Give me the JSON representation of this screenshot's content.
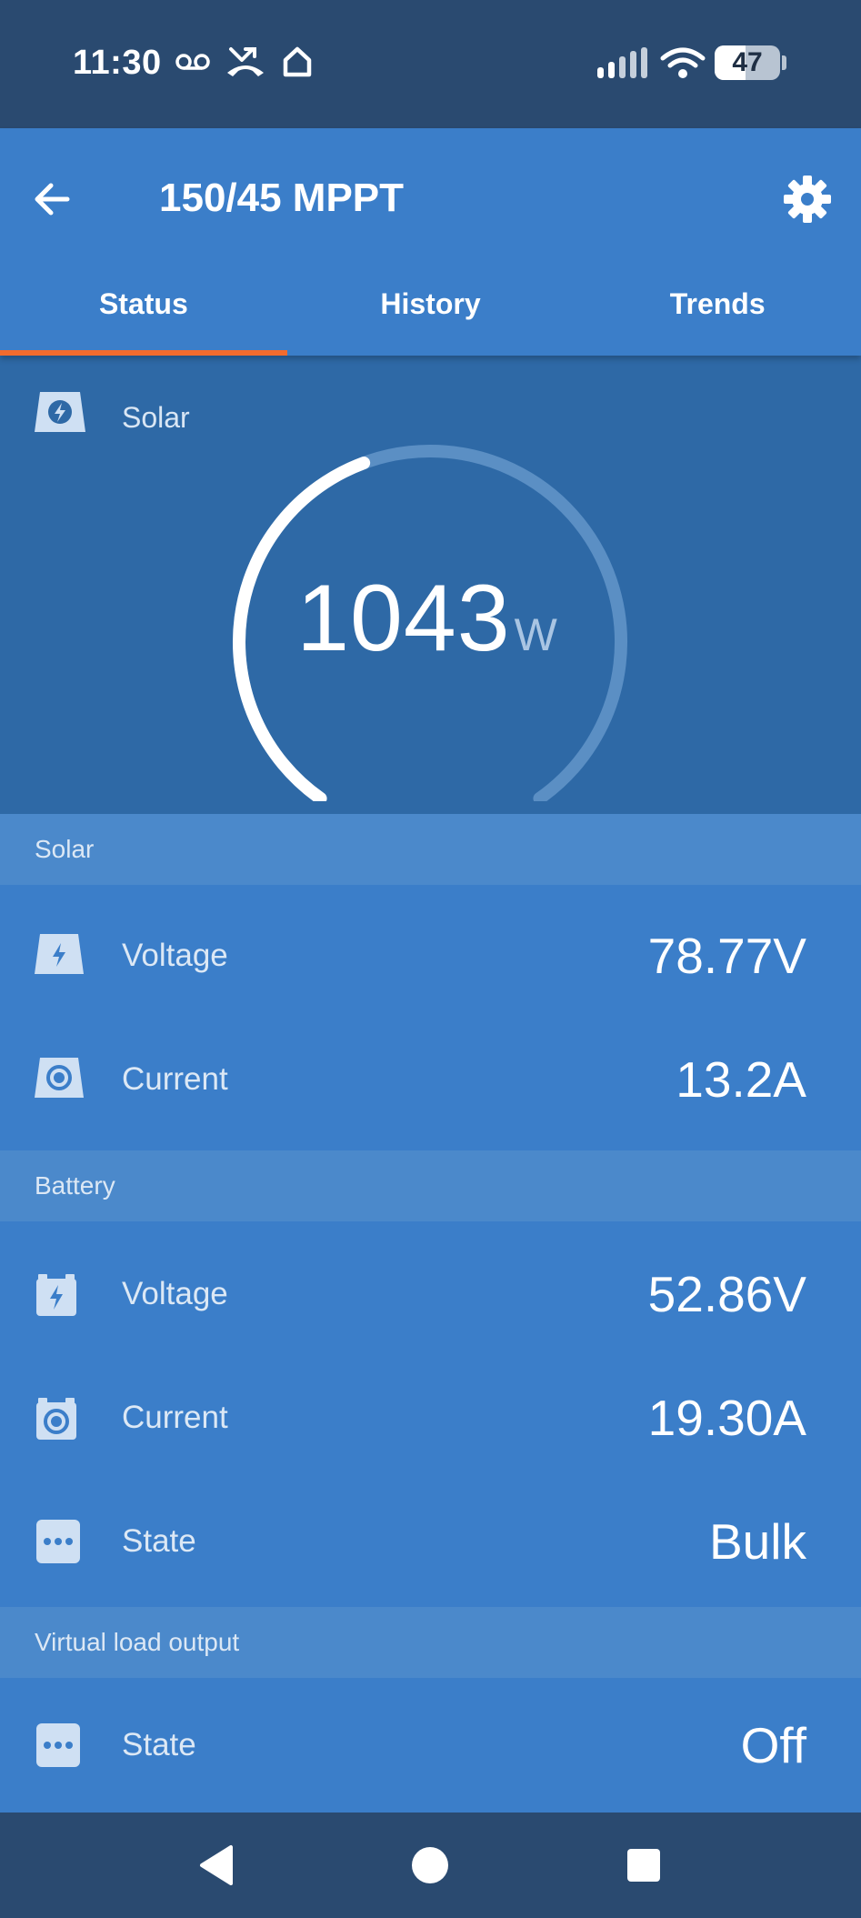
{
  "status_bar": {
    "time": "11:30",
    "battery_level": "47",
    "battery_fraction": 0.47,
    "icons": [
      "voicemail-icon",
      "missed-call-icon",
      "home-icon",
      "signal-icon",
      "wifi-icon",
      "battery-icon"
    ]
  },
  "app_bar": {
    "title": "150/45 MPPT",
    "back_icon": "arrow-left-icon",
    "settings_icon": "gear-icon"
  },
  "tabs": [
    {
      "label": "Status",
      "active": true
    },
    {
      "label": "History",
      "active": false
    },
    {
      "label": "Trends",
      "active": false
    }
  ],
  "hero": {
    "label": "Solar",
    "icon": "solar-panel-bolt-icon",
    "value": "1043",
    "unit": "W",
    "gauge_fraction": 0.43
  },
  "sections": {
    "solar": {
      "header": "Solar",
      "rows": [
        {
          "label": "Voltage",
          "value": "78.77V",
          "icon": "solar-panel-bolt-icon"
        },
        {
          "label": "Current",
          "value": "13.2A",
          "icon": "solar-panel-current-icon"
        }
      ]
    },
    "battery": {
      "header": "Battery",
      "rows": [
        {
          "label": "Voltage",
          "value": "52.86V",
          "icon": "battery-bolt-icon"
        },
        {
          "label": "Current",
          "value": "19.30A",
          "icon": "battery-current-icon"
        },
        {
          "label": "State",
          "value": "Bulk",
          "icon": "more-dots-icon"
        }
      ]
    },
    "load": {
      "header": "Virtual load output",
      "rows": [
        {
          "label": "State",
          "value": "Off",
          "icon": "more-dots-icon"
        }
      ]
    }
  },
  "colors": {
    "status_bar_bg": "#2a4a70",
    "app_bar_bg": "#3b7ec9",
    "hero_bg": "#2e69a6",
    "section_header_bg": "#4b89cb",
    "row_bg": "#3b7ec9",
    "tab_indicator": "#f26b2e"
  },
  "nav_bar": {
    "icons": [
      "back-triangle-icon",
      "home-circle-icon",
      "recents-square-icon"
    ]
  }
}
